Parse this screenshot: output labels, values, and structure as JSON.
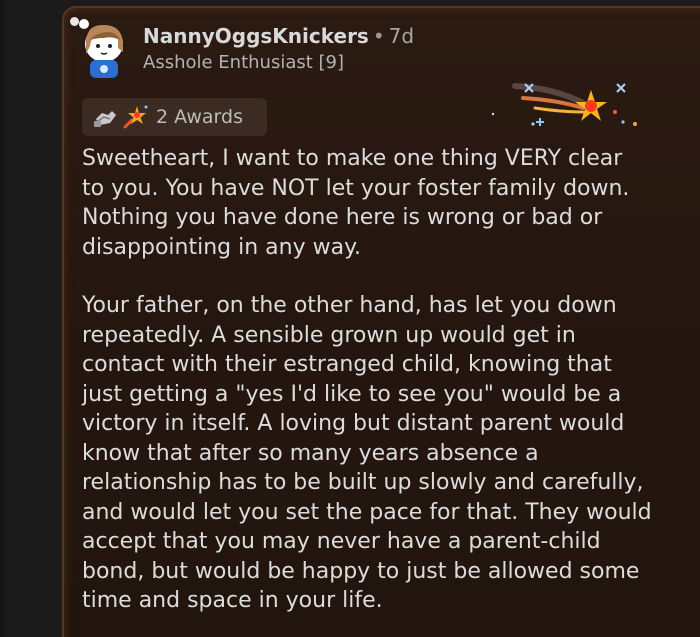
{
  "comment": {
    "username": "NannyOggsKnickers",
    "separator": "•",
    "timestamp": "7d",
    "flair": "Asshole Enthusiast [9]",
    "awards": {
      "label": "2 Awards",
      "icons": [
        "helping-hand-award-icon",
        "starry-award-icon"
      ]
    },
    "body": {
      "paragraphs": [
        "Sweetheart, I want to make one thing VERY clear\nto you. You have NOT let your foster family down.\nNothing you have done here is wrong or bad or\ndisappointing in any way.",
        "Your father, on the other hand, has let you down\nrepeatedly. A sensible grown up would get in\ncontact with their estranged child, knowing that\njust getting a \"yes I'd like to see you\" would be a\nvictory in itself. A loving but distant parent would\nknow that after so many years absence a\nrelationship has to be built up slowly and carefully,\nand would let you set the pace for that. They would\naccept that you may never have a parent-child\nbond, but would be happy to just be allowed some\ntime and space in your life."
      ]
    }
  },
  "colors": {
    "page_bg": "#1b1b1b",
    "card_bg": "#24160f",
    "card_border": "#5a3420",
    "text": "#dcdcdc",
    "muted_text": "#b3b3b3",
    "award_pill_bg": "#3b2b23"
  }
}
